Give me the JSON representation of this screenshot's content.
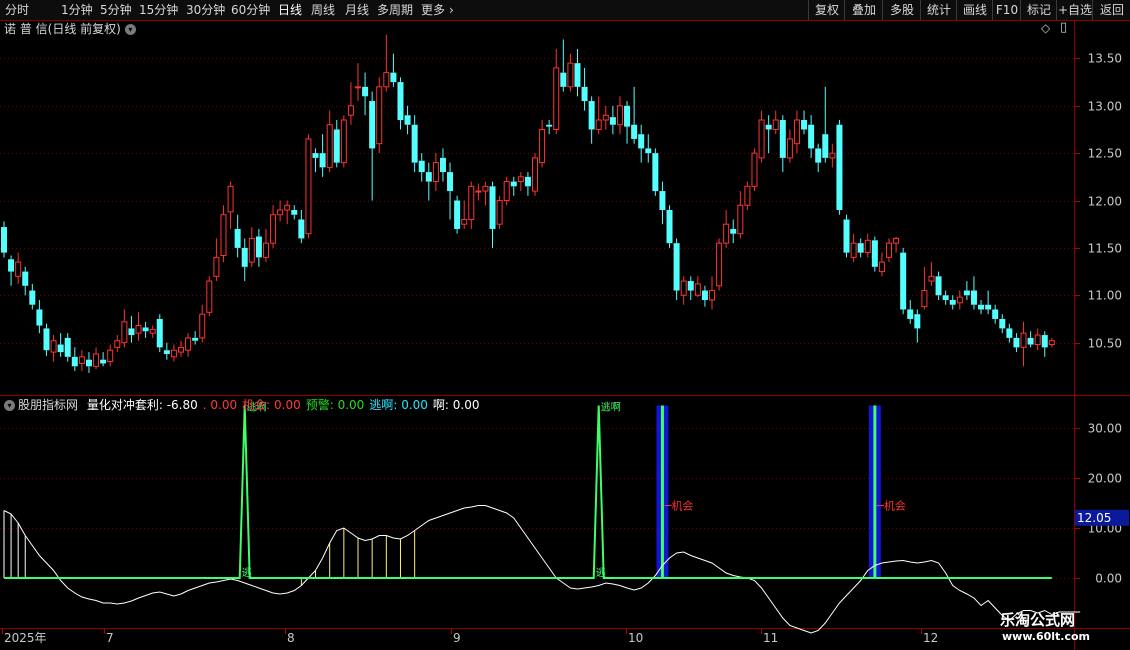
{
  "toolbar": {
    "periods": [
      "分时",
      "1分钟",
      "5分钟",
      "15分钟",
      "30分钟",
      "60分钟",
      "日线",
      "周线",
      "月线",
      "多周期",
      "更多"
    ],
    "active_period": "日线",
    "more_arrow": "›",
    "right_buttons": [
      "复权",
      "叠加",
      "多股",
      "统计",
      "画线",
      "F10",
      "标记",
      "+自选",
      "返回"
    ]
  },
  "chart_header": {
    "stock_name": "诺 普 信",
    "mode": "(日线 前复权)",
    "dropdown_icon": "chevron-down-icon",
    "diamond": "◇",
    "window_icon": "▯"
  },
  "indicator_header": {
    "name": "股朋指标网",
    "items": [
      {
        "label": "量化对冲套利:",
        "value": "-6.80",
        "color": "#ffffff"
      },
      {
        "label": ".",
        "value": "0.00",
        "color": "#ff3a3a"
      },
      {
        "label": "机会:",
        "value": "0.00",
        "color": "#ff3a3a"
      },
      {
        "label": "预警:",
        "value": "0.00",
        "color": "#22dd22"
      },
      {
        "label": "逃啊:",
        "value": "0.00",
        "color": "#22e6ff"
      },
      {
        "label": "啊:",
        "value": "0.00",
        "color": "#ffffff"
      }
    ]
  },
  "price_axis": {
    "ticks": [
      "13.50",
      "13.00",
      "12.50",
      "12.00",
      "11.50",
      "11.00",
      "10.50"
    ]
  },
  "indicator_axis": {
    "ticks": [
      "30.00",
      "20.00",
      "10.00",
      "0.00"
    ],
    "current_value": "12.05"
  },
  "time_axis": {
    "labels": [
      "2025年",
      "7",
      "8",
      "9",
      "10",
      "11",
      "12"
    ]
  },
  "chart_data": {
    "type": "candlestick",
    "price_ylim": [
      10.0,
      13.8
    ],
    "candles": [
      [
        11.72,
        11.45,
        11.78,
        11.4
      ],
      [
        11.38,
        11.25,
        11.42,
        11.1
      ],
      [
        11.2,
        11.35,
        11.45,
        11.12
      ],
      [
        11.25,
        11.1,
        11.3,
        11.0
      ],
      [
        11.05,
        10.9,
        11.12,
        10.85
      ],
      [
        10.85,
        10.68,
        10.95,
        10.6
      ],
      [
        10.65,
        10.42,
        10.7,
        10.36
      ],
      [
        10.4,
        10.52,
        10.58,
        10.3
      ],
      [
        10.48,
        10.4,
        10.6,
        10.35
      ],
      [
        10.55,
        10.35,
        10.6,
        10.3
      ],
      [
        10.35,
        10.25,
        10.45,
        10.2
      ],
      [
        10.28,
        10.35,
        10.42,
        10.2
      ],
      [
        10.32,
        10.25,
        10.4,
        10.18
      ],
      [
        10.25,
        10.38,
        10.45,
        10.22
      ],
      [
        10.32,
        10.28,
        10.4,
        10.25
      ],
      [
        10.3,
        10.42,
        10.48,
        10.25
      ],
      [
        10.45,
        10.52,
        10.58,
        10.4
      ],
      [
        10.5,
        10.72,
        10.85,
        10.45
      ],
      [
        10.65,
        10.58,
        10.78,
        10.5
      ],
      [
        10.6,
        10.68,
        10.82,
        10.52
      ],
      [
        10.66,
        10.62,
        10.72,
        10.55
      ],
      [
        10.6,
        10.64,
        10.68,
        10.55
      ],
      [
        10.75,
        10.45,
        10.8,
        10.4
      ],
      [
        10.42,
        10.38,
        10.5,
        10.32
      ],
      [
        10.35,
        10.42,
        10.48,
        10.3
      ],
      [
        10.4,
        10.45,
        10.52,
        10.35
      ],
      [
        10.42,
        10.55,
        10.6,
        10.35
      ],
      [
        10.55,
        10.52,
        10.62,
        10.48
      ],
      [
        10.55,
        10.8,
        10.9,
        10.5
      ],
      [
        10.82,
        11.15,
        11.2,
        10.78
      ],
      [
        11.2,
        11.4,
        11.6,
        11.15
      ],
      [
        11.42,
        11.85,
        11.95,
        11.35
      ],
      [
        11.88,
        12.15,
        12.2,
        11.7
      ],
      [
        11.7,
        11.5,
        11.85,
        11.4
      ],
      [
        11.5,
        11.3,
        11.6,
        11.15
      ],
      [
        11.35,
        11.6,
        11.72,
        11.3
      ],
      [
        11.62,
        11.4,
        11.7,
        11.3
      ],
      [
        11.4,
        11.55,
        11.7,
        11.35
      ],
      [
        11.55,
        11.85,
        11.95,
        11.5
      ],
      [
        11.85,
        11.9,
        12.0,
        11.78
      ],
      [
        11.9,
        11.95,
        12.0,
        11.75
      ],
      [
        11.9,
        11.85,
        11.95,
        11.8
      ],
      [
        11.8,
        11.6,
        11.9,
        11.55
      ],
      [
        11.65,
        12.65,
        12.7,
        11.6
      ],
      [
        12.5,
        12.45,
        12.55,
        12.3
      ],
      [
        12.5,
        12.35,
        12.7,
        12.25
      ],
      [
        12.35,
        12.8,
        12.95,
        12.3
      ],
      [
        12.75,
        12.4,
        12.85,
        12.35
      ],
      [
        12.4,
        12.85,
        12.9,
        12.35
      ],
      [
        12.9,
        13.0,
        13.25,
        12.8
      ],
      [
        13.2,
        13.2,
        13.45,
        13.05
      ],
      [
        13.2,
        13.1,
        13.35,
        12.9
      ],
      [
        13.05,
        12.55,
        13.15,
        12.0
      ],
      [
        12.6,
        13.2,
        13.3,
        12.5
      ],
      [
        13.2,
        13.35,
        13.75,
        13.15
      ],
      [
        13.35,
        13.25,
        13.55,
        13.2
      ],
      [
        13.25,
        12.85,
        13.3,
        12.75
      ],
      [
        12.9,
        12.8,
        13.0,
        12.7
      ],
      [
        12.8,
        12.4,
        12.9,
        12.3
      ],
      [
        12.42,
        12.3,
        12.5,
        12.2
      ],
      [
        12.3,
        12.2,
        12.4,
        12.0
      ],
      [
        12.2,
        12.4,
        12.5,
        12.1
      ],
      [
        12.45,
        12.3,
        12.55,
        12.2
      ],
      [
        12.3,
        12.1,
        12.4,
        11.8
      ],
      [
        12.0,
        11.7,
        12.05,
        11.65
      ],
      [
        11.75,
        11.8,
        12.0,
        11.7
      ],
      [
        11.8,
        12.15,
        12.2,
        11.7
      ],
      [
        12.1,
        12.1,
        12.18,
        12.0
      ],
      [
        12.1,
        12.15,
        12.2,
        11.95
      ],
      [
        12.15,
        11.7,
        12.2,
        11.5
      ],
      [
        11.75,
        12.0,
        12.05,
        11.7
      ],
      [
        12.0,
        12.2,
        12.25,
        11.95
      ],
      [
        12.2,
        12.15,
        12.25,
        12.05
      ],
      [
        12.2,
        12.25,
        12.3,
        12.1
      ],
      [
        12.25,
        12.15,
        12.3,
        12.05
      ],
      [
        12.1,
        12.45,
        12.5,
        12.05
      ],
      [
        12.4,
        12.75,
        12.85,
        12.35
      ],
      [
        12.8,
        12.78,
        12.85,
        12.7
      ],
      [
        12.75,
        13.4,
        13.6,
        12.7
      ],
      [
        13.35,
        13.2,
        13.7,
        13.15
      ],
      [
        13.2,
        13.45,
        13.55,
        13.15
      ],
      [
        13.45,
        13.2,
        13.6,
        13.1
      ],
      [
        13.2,
        13.05,
        13.4,
        12.95
      ],
      [
        13.05,
        12.75,
        13.1,
        12.6
      ],
      [
        12.75,
        12.85,
        13.1,
        12.7
      ],
      [
        12.85,
        12.9,
        13.0,
        12.75
      ],
      [
        12.88,
        12.8,
        13.0,
        12.7
      ],
      [
        12.8,
        13.0,
        13.1,
        12.7
      ],
      [
        13.0,
        12.78,
        13.05,
        12.6
      ],
      [
        12.8,
        12.65,
        13.2,
        12.6
      ],
      [
        12.7,
        12.55,
        12.8,
        12.4
      ],
      [
        12.55,
        12.5,
        12.7,
        12.4
      ],
      [
        12.5,
        12.1,
        12.55,
        12.05
      ],
      [
        12.1,
        11.9,
        12.2,
        11.75
      ],
      [
        11.9,
        11.55,
        11.95,
        11.5
      ],
      [
        11.55,
        11.05,
        11.6,
        10.95
      ],
      [
        11.0,
        11.15,
        11.2,
        10.9
      ],
      [
        11.15,
        11.05,
        11.2,
        10.95
      ],
      [
        11.0,
        11.12,
        11.2,
        10.98
      ],
      [
        11.05,
        10.95,
        11.1,
        10.88
      ],
      [
        10.95,
        11.05,
        11.2,
        10.85
      ],
      [
        11.1,
        11.55,
        11.6,
        11.05
      ],
      [
        11.55,
        11.75,
        11.9,
        11.5
      ],
      [
        11.7,
        11.65,
        11.8,
        11.55
      ],
      [
        11.65,
        11.95,
        12.1,
        11.6
      ],
      [
        11.95,
        12.15,
        12.2,
        11.9
      ],
      [
        12.15,
        12.5,
        12.55,
        12.1
      ],
      [
        12.45,
        12.85,
        12.95,
        12.4
      ],
      [
        12.8,
        12.75,
        12.9,
        12.5
      ],
      [
        12.75,
        12.85,
        12.95,
        12.7
      ],
      [
        12.85,
        12.45,
        12.9,
        12.3
      ],
      [
        12.45,
        12.65,
        12.75,
        12.4
      ],
      [
        12.6,
        12.85,
        12.95,
        12.5
      ],
      [
        12.85,
        12.75,
        12.95,
        12.7
      ],
      [
        12.8,
        12.55,
        12.9,
        12.45
      ],
      [
        12.55,
        12.4,
        12.6,
        12.3
      ],
      [
        12.7,
        12.45,
        13.2,
        12.4
      ],
      [
        12.45,
        12.5,
        12.6,
        12.35
      ],
      [
        12.8,
        11.9,
        12.85,
        11.85
      ],
      [
        11.8,
        11.45,
        11.85,
        11.4
      ],
      [
        11.4,
        11.55,
        11.65,
        11.35
      ],
      [
        11.55,
        11.45,
        11.6,
        11.4
      ],
      [
        11.45,
        11.58,
        11.65,
        11.4
      ],
      [
        11.58,
        11.3,
        11.62,
        11.25
      ],
      [
        11.25,
        11.35,
        11.45,
        11.2
      ],
      [
        11.4,
        11.55,
        11.6,
        11.35
      ],
      [
        11.55,
        11.6,
        11.62,
        11.45
      ],
      [
        11.45,
        10.85,
        11.5,
        10.8
      ],
      [
        10.85,
        10.75,
        10.95,
        10.7
      ],
      [
        10.8,
        10.65,
        10.85,
        10.5
      ],
      [
        10.88,
        11.05,
        11.3,
        10.85
      ],
      [
        11.15,
        11.2,
        11.35,
        11.1
      ],
      [
        11.2,
        11.0,
        11.25,
        10.95
      ],
      [
        11.0,
        10.95,
        11.05,
        10.9
      ],
      [
        10.95,
        10.9,
        11.0,
        10.85
      ],
      [
        10.92,
        10.98,
        11.05,
        10.85
      ],
      [
        11.05,
        11.0,
        11.15,
        10.95
      ],
      [
        11.05,
        10.9,
        11.2,
        10.85
      ],
      [
        10.9,
        10.85,
        10.95,
        10.8
      ],
      [
        10.9,
        10.85,
        11.05,
        10.8
      ],
      [
        10.85,
        10.75,
        10.9,
        10.7
      ],
      [
        10.75,
        10.65,
        10.8,
        10.6
      ],
      [
        10.65,
        10.55,
        10.7,
        10.5
      ],
      [
        10.55,
        10.45,
        10.6,
        10.4
      ],
      [
        10.45,
        10.6,
        10.72,
        10.25
      ],
      [
        10.55,
        10.48,
        10.62,
        10.45
      ],
      [
        10.48,
        10.58,
        10.65,
        10.42
      ],
      [
        10.58,
        10.45,
        10.62,
        10.35
      ],
      [
        10.48,
        10.52,
        10.55,
        10.45
      ]
    ],
    "indicator_ylim": [
      -10,
      36
    ],
    "oscillator": [
      13.5,
      12.8,
      11,
      8.5,
      6.5,
      4.5,
      3,
      1.5,
      -0.5,
      -2,
      -3,
      -3.8,
      -4.2,
      -4.5,
      -5,
      -5,
      -5.2,
      -5,
      -4.6,
      -4,
      -3.5,
      -3,
      -2.8,
      -3.2,
      -3.6,
      -3.2,
      -2.5,
      -2,
      -1.5,
      -1,
      -0.8,
      -0.5,
      -0.2,
      -0.5,
      -1,
      -1.5,
      -2,
      -2.5,
      -3,
      -3.2,
      -3,
      -2.5,
      -1.5,
      0,
      1.5,
      4,
      7,
      9.5,
      10,
      9,
      8,
      7.5,
      7.8,
      8.5,
      8.5,
      8,
      7.8,
      8.5,
      9.5,
      10.5,
      11.5,
      12,
      12.5,
      13,
      13.5,
      14,
      14.2,
      14.5,
      14.5,
      14,
      13.5,
      13,
      12,
      10,
      8,
      6,
      4,
      2,
      0,
      -1,
      -2,
      -2.2,
      -2,
      -1.8,
      -1.5,
      -1,
      -1.2,
      -1.5,
      -2,
      -2.4,
      -2,
      -1,
      0.5,
      2.5,
      4,
      5,
      5.2,
      4.5,
      4,
      3.5,
      3,
      2,
      1,
      0.5,
      0.2,
      0,
      -0.5,
      -2,
      -4,
      -6,
      -8,
      -9.5,
      -10,
      -10.5,
      -11,
      -10.5,
      -9,
      -7,
      -5,
      -3.5,
      -2,
      -0.5,
      1.5,
      2.5,
      3,
      3.2,
      3.4,
      3.5,
      3.2,
      3,
      3.2,
      3.5,
      3,
      1,
      -1.5,
      -2.5,
      -3.2,
      -4,
      -5.5,
      -4.5,
      -6,
      -7.5,
      -8.5,
      -7.2,
      -6.5,
      -6.5,
      -7,
      -6.5,
      -7.3,
      -6.8,
      -6.8,
      -6.8,
      -6.8
    ],
    "signal_spikes": [
      {
        "index": 34,
        "value": 34.5,
        "label": "逃啊",
        "mark": "逃"
      },
      {
        "index": 84,
        "value": 34.5,
        "label": "逃啊",
        "mark": "逃"
      }
    ],
    "yellow_bars": {
      "from": 42,
      "to": 59,
      "step": 2
    },
    "opportunity_bars": [
      {
        "index": 93,
        "label": "机会"
      },
      {
        "index": 123,
        "label": "机会"
      }
    ],
    "left_bars": {
      "from": 0,
      "to": 3
    }
  }
}
